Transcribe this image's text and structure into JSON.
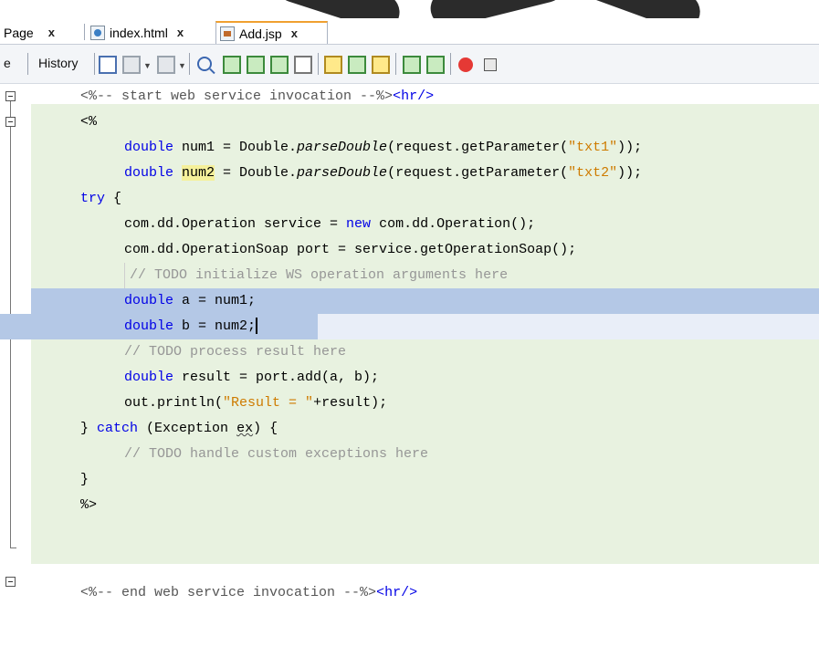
{
  "tabs": [
    {
      "label": "Page",
      "close": "x",
      "active": false
    },
    {
      "label": "index.html",
      "close": "x",
      "active": false
    },
    {
      "label": "Add.jsp",
      "close": "x",
      "active": true
    }
  ],
  "toolbar": {
    "source_label_partial": "e",
    "history_label": "History"
  },
  "code": {
    "l0": {
      "a": "<%-- start web service invocation --%>",
      "b": "<hr/>"
    },
    "l1": {
      "a": "<%"
    },
    "l2": {
      "a": "double ",
      "b": "num1 = Double.",
      "c": "parseDouble",
      "d": "(request.getParameter(",
      "e": "\"txt1\"",
      "f": "));"
    },
    "l3": {
      "a": "double ",
      "b": "num2",
      "c": " = Double.",
      "d": "parseDouble",
      "e": "(request.getParameter(",
      "f": "\"txt2\"",
      "g": "));"
    },
    "l4": {
      "a": "try",
      "b": " {"
    },
    "l5": {
      "a": "com.dd.Operation service = ",
      "b": "new",
      "c": " com.dd.Operation();"
    },
    "l6": {
      "a": "com.dd.OperationSoap port = service.getOperationSoap();"
    },
    "l7": {
      "a": "// TODO initialize WS operation arguments here"
    },
    "l8": {
      "a": "double",
      "b": " a = num1;"
    },
    "l9": {
      "a": "double",
      "b": " b = num2;"
    },
    "l10": {
      "a": "// TODO process result here"
    },
    "l11": {
      "a": "double",
      "b": " result = port.add(a, b);"
    },
    "l12": {
      "a": "out.println(",
      "b": "\"Result = \"",
      "c": "+result);"
    },
    "l13": {
      "a": "} ",
      "b": "catch",
      "c": " (Exception ",
      "d": "ex",
      "e": ") {"
    },
    "l14": {
      "a": "// TODO handle custom exceptions here"
    },
    "l15": {
      "a": "}"
    },
    "l16": {
      "a": "%>"
    },
    "l17": {
      "a": "<%-- end web service invocation --%>",
      "b": "<hr/>"
    }
  },
  "colors": {
    "keyword": "#0000e6",
    "string": "#ce7b00",
    "comment": "#969696",
    "jsp_block_bg": "#e8f2e0",
    "selection": "#b4c8e6",
    "active_tab_accent": "#f0a030"
  }
}
